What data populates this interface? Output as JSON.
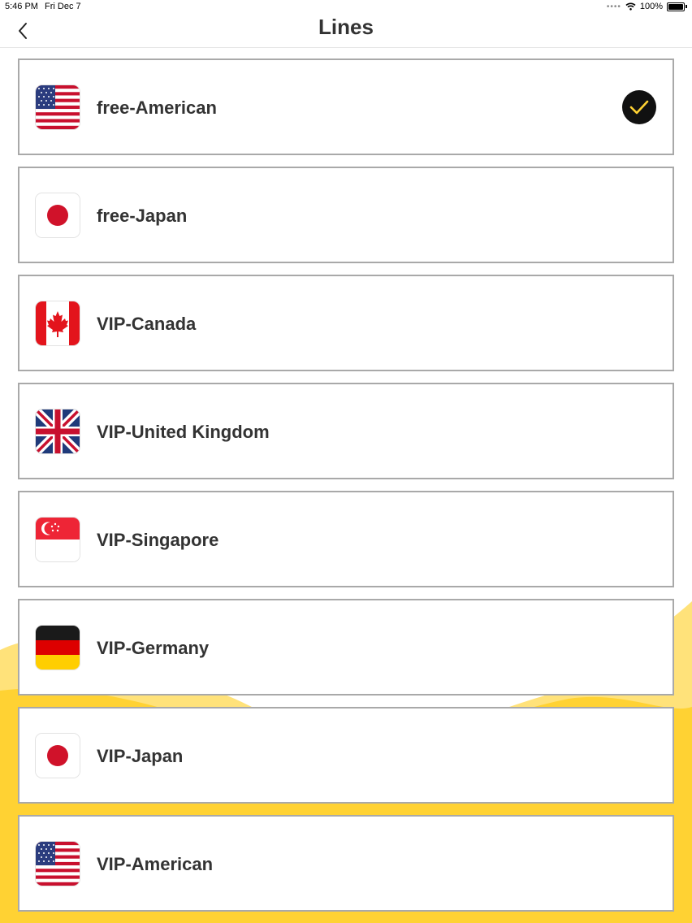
{
  "status_bar": {
    "time": "5:46 PM",
    "date": "Fri Dec 7",
    "battery": "100%"
  },
  "nav": {
    "title": "Lines",
    "back_icon": "chevron-left-icon"
  },
  "colors": {
    "accent_yellow": "#FFD233",
    "check_bg": "#111111",
    "check_mark": "#FFD233",
    "border": "#A9A9A9"
  },
  "lines": [
    {
      "name": "free-American",
      "flag": "us-flag-icon",
      "selected": true
    },
    {
      "name": "free-Japan",
      "flag": "japan-flag-icon",
      "selected": false
    },
    {
      "name": "VIP-Canada",
      "flag": "canada-flag-icon",
      "selected": false
    },
    {
      "name": "VIP-United Kingdom",
      "flag": "uk-flag-icon",
      "selected": false
    },
    {
      "name": "VIP-Singapore",
      "flag": "singapore-flag-icon",
      "selected": false
    },
    {
      "name": "VIP-Germany",
      "flag": "germany-flag-icon",
      "selected": false
    },
    {
      "name": "VIP-Japan",
      "flag": "japan-flag-icon",
      "selected": false
    },
    {
      "name": "VIP-American",
      "flag": "us-flag-icon",
      "selected": false
    }
  ]
}
